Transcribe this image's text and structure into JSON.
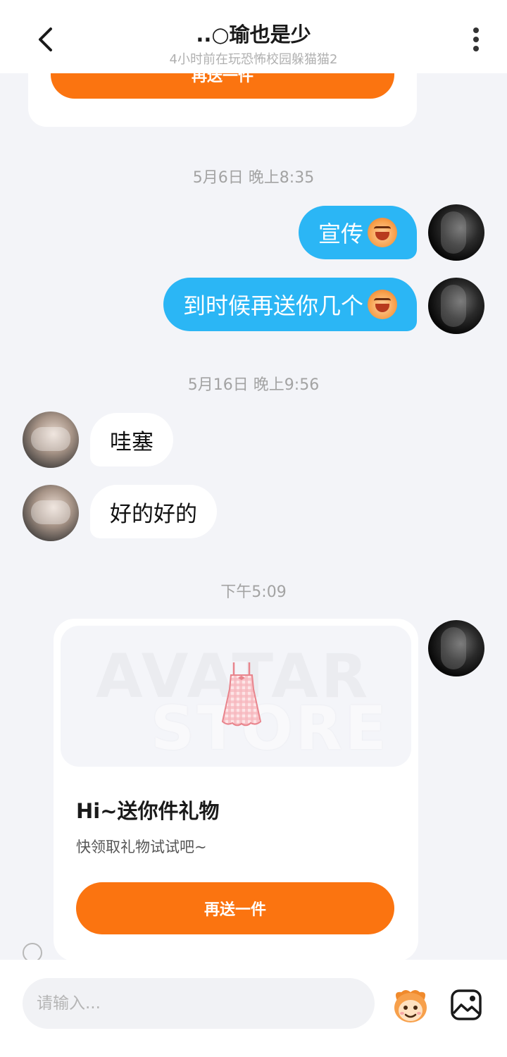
{
  "header": {
    "title": "..○瑜也是少",
    "subtitle": "4小时前在玩恐怖校园躲猫猫2"
  },
  "top_card": {
    "button_label": "再送一件"
  },
  "messages": [
    {
      "type": "timestamp",
      "text": "5月6日 晚上8:35"
    },
    {
      "type": "sent",
      "text": "宣传",
      "emoji": "monkey-laugh"
    },
    {
      "type": "sent",
      "text": "到时候再送你几个",
      "emoji": "monkey-laugh"
    },
    {
      "type": "timestamp",
      "text": "5月16日 晚上9:56"
    },
    {
      "type": "received",
      "text": "哇塞"
    },
    {
      "type": "received",
      "text": "好的好的"
    },
    {
      "type": "timestamp",
      "text": "下午5:09"
    }
  ],
  "gift_card": {
    "watermark_line1": "AVATAR",
    "watermark_line2": "STORE",
    "title": "Hi~送你件礼物",
    "description": "快领取礼物试试吧~",
    "button_label": "再送一件",
    "item_icon": "dress-icon"
  },
  "input": {
    "placeholder": "请输入..."
  },
  "icons": {
    "back": "chevron-left-icon",
    "more": "more-vertical-icon",
    "emoji": "emoji-icon",
    "image": "image-icon"
  },
  "colors": {
    "accent_orange": "#fb7410",
    "sent_bubble": "#2bb6f5",
    "background": "#f3f4f8"
  }
}
